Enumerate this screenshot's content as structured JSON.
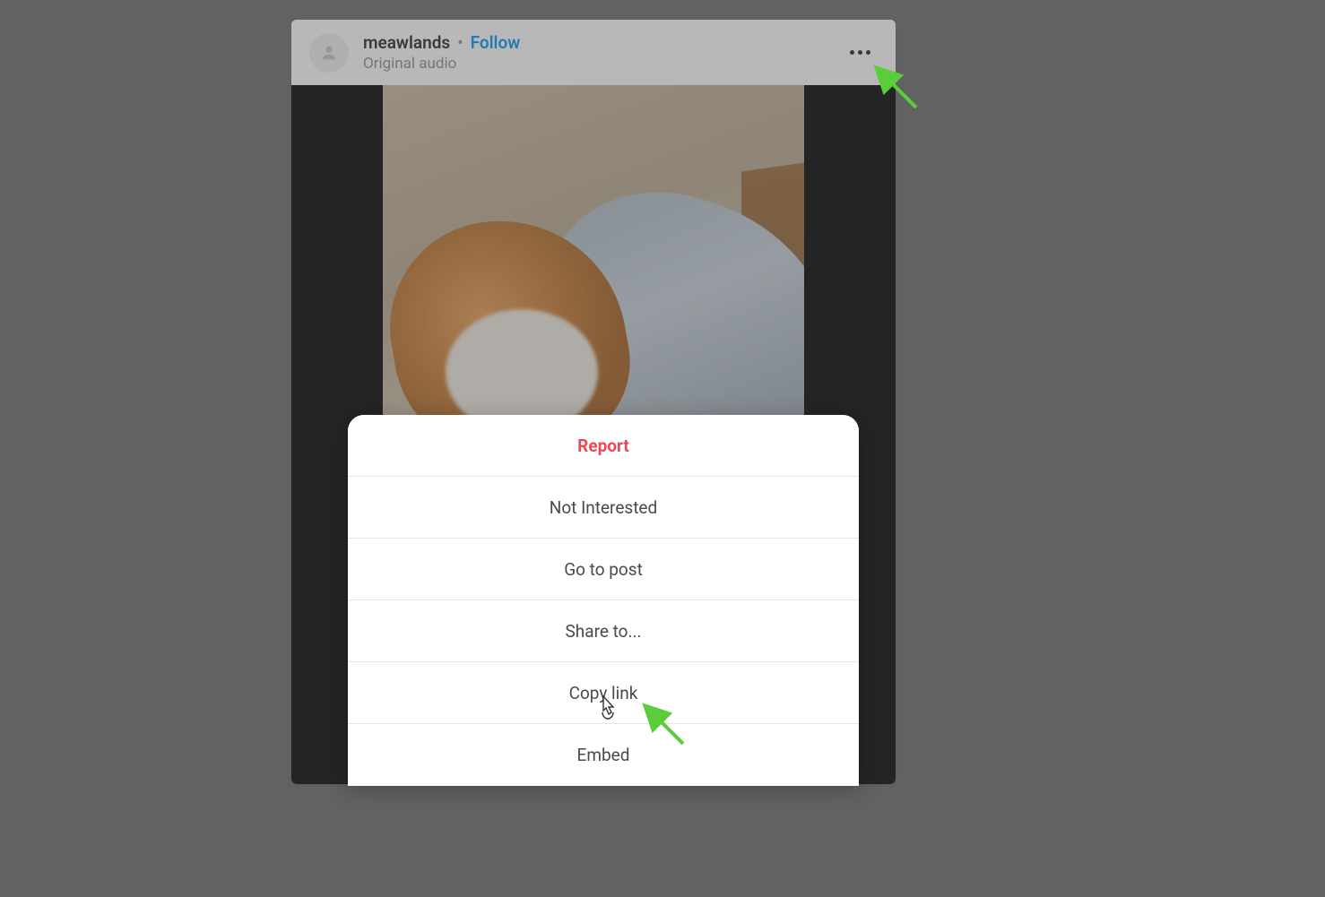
{
  "post": {
    "header": {
      "username": "meawlands",
      "separator": "•",
      "follow_label": "Follow",
      "subtitle": "Original audio"
    }
  },
  "menu": {
    "items": [
      {
        "label": "Report",
        "danger": true
      },
      {
        "label": "Not Interested",
        "danger": false
      },
      {
        "label": "Go to post",
        "danger": false
      },
      {
        "label": "Share to...",
        "danger": false
      },
      {
        "label": "Copy link",
        "danger": false
      },
      {
        "label": "Embed",
        "danger": false
      }
    ]
  },
  "annotations": {
    "arrow_color": "#5bcc3a"
  }
}
